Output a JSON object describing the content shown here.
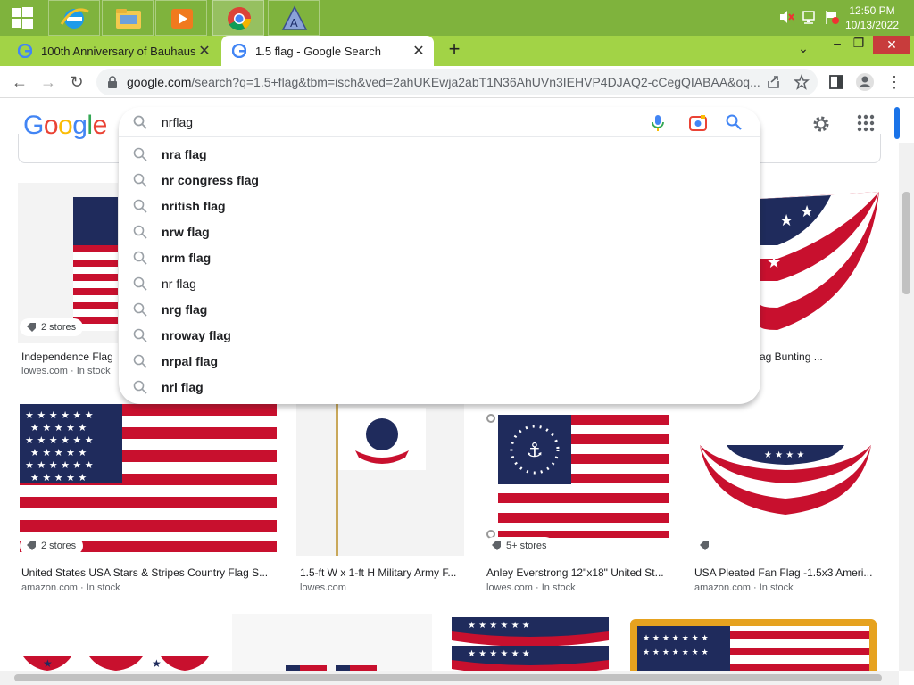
{
  "taskbar": {
    "apps": [
      "windows-start",
      "internet-explorer",
      "file-explorer",
      "media-player",
      "chrome",
      "app-a"
    ],
    "clock_time": "12:50 PM",
    "clock_date": "10/13/2022"
  },
  "tabs": [
    {
      "title": "100th Anniversary of Bauhaus",
      "active": false
    },
    {
      "title": "1.5 flag - Google Search",
      "active": true
    }
  ],
  "address": {
    "host": "google.com",
    "path": "/search?q=1.5+flag&tbm=isch&ved=2ahUKEwja2abT1N36AhUVn3IEHVP4DJAQ2-cCegQIABAA&oq..."
  },
  "search": {
    "value": "nrflag",
    "suggestions": [
      {
        "text": "nra flag",
        "bold": true
      },
      {
        "text": "nr congress flag",
        "bold": true
      },
      {
        "text": "nritish flag",
        "bold": true
      },
      {
        "text": "nrw flag",
        "bold": true
      },
      {
        "text": "nrm flag",
        "bold": true
      },
      {
        "text": "nr flag",
        "bold": false
      },
      {
        "text": "nrg flag",
        "bold": true
      },
      {
        "text": "nroway flag",
        "bold": true
      },
      {
        "text": "nrpal flag",
        "bold": true
      },
      {
        "text": "nrl flag",
        "bold": true
      }
    ]
  },
  "results_row1": [
    {
      "title": "Independence Flag",
      "source": "lowes.com · In stock",
      "stores": "2 stores"
    },
    {
      "title": "ag Bunting ...",
      "source": "",
      "stores": ""
    }
  ],
  "results_row2": [
    {
      "title": "United States USA Stars & Stripes Country Flag S...",
      "source": "amazon.com · In stock",
      "stores": "2 stores"
    },
    {
      "title": "1.5-ft W x 1-ft H Military Army F...",
      "source": "lowes.com",
      "stores": ""
    },
    {
      "title": "Anley Everstrong 12\"x18\" United St...",
      "source": "lowes.com · In stock",
      "stores": "5+ stores"
    },
    {
      "title": "USA Pleated Fan Flag -1.5x3 Ameri...",
      "source": "amazon.com · In stock",
      "stores": ""
    }
  ],
  "colors": {
    "taskbar": "#7fb33d",
    "tabstrip": "#a2d346",
    "google_blue": "#4285F4",
    "google_red": "#EA4335",
    "google_yellow": "#FBBC05",
    "google_green": "#34A853",
    "flag_red": "#c8102e",
    "flag_blue": "#1f2b5c"
  }
}
